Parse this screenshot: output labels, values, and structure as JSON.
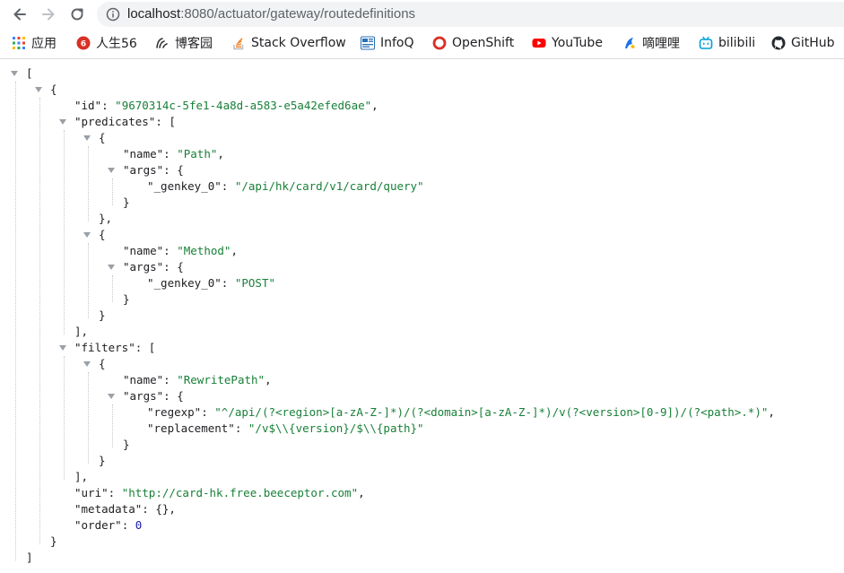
{
  "browser": {
    "url_host": "localhost",
    "url_rest": ":8080/actuator/gateway/routedefinitions"
  },
  "bookmarks": [
    {
      "label": "应用",
      "icon": "apps-grid-icon",
      "color": "#4285f4"
    },
    {
      "label": "人生56",
      "icon": "rensheng56-icon",
      "color": "#d93025"
    },
    {
      "label": "博客园",
      "icon": "cnblogs-icon",
      "color": "#333333"
    },
    {
      "label": "Stack Overflow",
      "icon": "stackoverflow-icon",
      "color": "#f48024"
    },
    {
      "label": "InfoQ",
      "icon": "infoq-icon",
      "color": "#2a6fb5"
    },
    {
      "label": "OpenShift",
      "icon": "openshift-icon",
      "color": "#d93025"
    },
    {
      "label": "YouTube",
      "icon": "youtube-icon",
      "color": "#ff0000"
    },
    {
      "label": "嘀哩哩",
      "icon": "dilidili-icon",
      "color": "#1a73e8"
    },
    {
      "label": "bilibili",
      "icon": "bilibili-icon",
      "color": "#00a1d6"
    },
    {
      "label": "GitHub",
      "icon": "github-icon",
      "color": "#24292e"
    }
  ],
  "json": {
    "lines": [
      [
        [
          "p",
          "["
        ]
      ],
      [
        [
          "p",
          "{"
        ]
      ],
      [
        [
          "k",
          "\"id\""
        ],
        [
          "p",
          ": "
        ],
        [
          "s",
          "\"9670314c-5fe1-4a8d-a583-e5a42efed6ae\""
        ],
        [
          "p",
          ","
        ]
      ],
      [
        [
          "k",
          "\"predicates\""
        ],
        [
          "p",
          ": ["
        ]
      ],
      [
        [
          "p",
          "{"
        ]
      ],
      [
        [
          "k",
          "\"name\""
        ],
        [
          "p",
          ": "
        ],
        [
          "s",
          "\"Path\""
        ],
        [
          "p",
          ","
        ]
      ],
      [
        [
          "k",
          "\"args\""
        ],
        [
          "p",
          ": {"
        ]
      ],
      [
        [
          "k",
          "\"_genkey_0\""
        ],
        [
          "p",
          ": "
        ],
        [
          "s",
          "\"/api/hk/card/v1/card/query\""
        ]
      ],
      [
        [
          "p",
          "}"
        ]
      ],
      [
        [
          "p",
          "},"
        ]
      ],
      [
        [
          "p",
          "{"
        ]
      ],
      [
        [
          "k",
          "\"name\""
        ],
        [
          "p",
          ": "
        ],
        [
          "s",
          "\"Method\""
        ],
        [
          "p",
          ","
        ]
      ],
      [
        [
          "k",
          "\"args\""
        ],
        [
          "p",
          ": {"
        ]
      ],
      [
        [
          "k",
          "\"_genkey_0\""
        ],
        [
          "p",
          ": "
        ],
        [
          "s",
          "\"POST\""
        ]
      ],
      [
        [
          "p",
          "}"
        ]
      ],
      [
        [
          "p",
          "}"
        ]
      ],
      [
        [
          "p",
          "],"
        ]
      ],
      [
        [
          "k",
          "\"filters\""
        ],
        [
          "p",
          ": ["
        ]
      ],
      [
        [
          "p",
          "{"
        ]
      ],
      [
        [
          "k",
          "\"name\""
        ],
        [
          "p",
          ": "
        ],
        [
          "s",
          "\"RewritePath\""
        ],
        [
          "p",
          ","
        ]
      ],
      [
        [
          "k",
          "\"args\""
        ],
        [
          "p",
          ": {"
        ]
      ],
      [
        [
          "k",
          "\"regexp\""
        ],
        [
          "p",
          ": "
        ],
        [
          "s",
          "\"^/api/(?<region>[a-zA-Z-]*)/(?<domain>[a-zA-Z-]*)/v(?<version>[0-9])/(?<path>.*)\""
        ],
        [
          "p",
          ","
        ]
      ],
      [
        [
          "k",
          "\"replacement\""
        ],
        [
          "p",
          ": "
        ],
        [
          "s",
          "\"/v$\\\\{version}/$\\\\{path}\""
        ]
      ],
      [
        [
          "p",
          "}"
        ]
      ],
      [
        [
          "p",
          "}"
        ]
      ],
      [
        [
          "p",
          "],"
        ]
      ],
      [
        [
          "k",
          "\"uri\""
        ],
        [
          "p",
          ": "
        ],
        [
          "s",
          "\"http://card-hk.free.beeceptor.com\""
        ],
        [
          "p",
          ","
        ]
      ],
      [
        [
          "k",
          "\"metadata\""
        ],
        [
          "p",
          ": {},"
        ]
      ],
      [
        [
          "k",
          "\"order\""
        ],
        [
          "p",
          ": "
        ],
        [
          "n",
          "0"
        ]
      ],
      [
        [
          "p",
          "}"
        ]
      ],
      [
        [
          "p",
          "]"
        ]
      ]
    ]
  },
  "colors": {
    "key": "#202124",
    "string": "#188038",
    "number": "#1a1aa6",
    "caret": "#9aa0a6",
    "guide": "#c8c8c8"
  }
}
